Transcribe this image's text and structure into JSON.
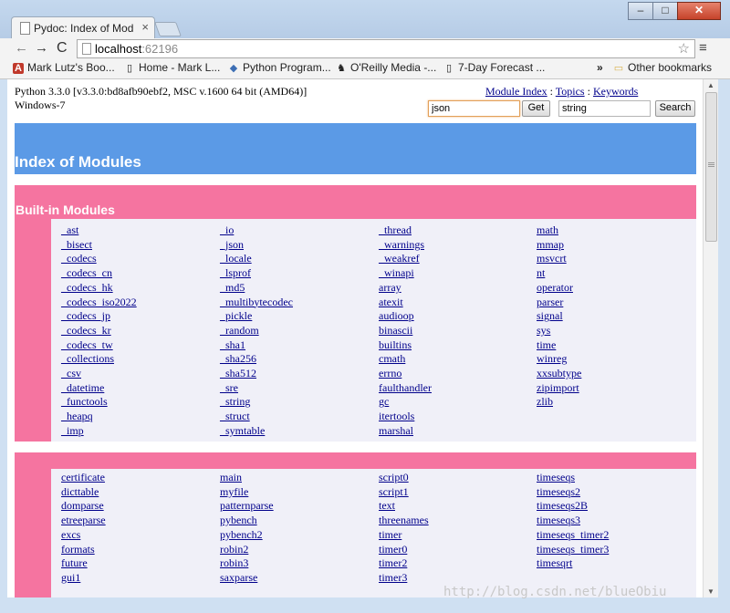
{
  "browser": {
    "tab_title": "Pydoc: Index of Mod",
    "tab_close": "×",
    "url_host": "localhost",
    "url_port": ":62196",
    "window_controls": {
      "minimize": "–",
      "maximize": "□",
      "close": "✕"
    },
    "nav_icons": {
      "back": "←",
      "forward": "→",
      "reload": "C",
      "star": "☆",
      "menu": "≡"
    },
    "bookmarks": [
      {
        "label": "Mark Lutz's Boo...",
        "icon": "acrobat-icon",
        "glyph": "A"
      },
      {
        "label": "Home - Mark L...",
        "icon": "page-icon",
        "glyph": "▯"
      },
      {
        "label": "Python Program...",
        "icon": "python-icon",
        "glyph": "◆"
      },
      {
        "label": "O'Reilly Media -...",
        "icon": "oreilly-icon",
        "glyph": "♞"
      },
      {
        "label": "7-Day Forecast ...",
        "icon": "page-icon",
        "glyph": "▯"
      }
    ],
    "bookmarks_more": "»",
    "other_bookmarks": {
      "label": "Other bookmarks",
      "glyph": "▭"
    }
  },
  "page": {
    "version_line1": "Python 3.3.0 [v3.3.0:bd8afb90ebf2, MSC v.1600 64 bit (AMD64)]",
    "version_line2": "Windows-7",
    "links": {
      "module_index": "Module Index",
      "topics": "Topics",
      "keywords": "Keywords",
      "separator": " : "
    },
    "get_input_value": "json",
    "get_button": "Get",
    "search_input_value": "string",
    "search_button": "Search",
    "index_title": "Index of Modules",
    "builtin_title": "Built-in Modules",
    "builtin_columns": [
      [
        "_ast",
        "_bisect",
        "_codecs",
        "_codecs_cn",
        "_codecs_hk",
        "_codecs_iso2022",
        "_codecs_jp",
        "_codecs_kr",
        "_codecs_tw",
        "_collections",
        "_csv",
        "_datetime",
        "_functools",
        "_heapq",
        "_imp"
      ],
      [
        "_io",
        "_json",
        "_locale",
        "_lsprof",
        "_md5",
        "_multibytecodec",
        "_pickle",
        "_random",
        "_sha1",
        "_sha256",
        "_sha512",
        "_sre",
        "_string",
        "_struct",
        "_symtable"
      ],
      [
        "_thread",
        "_warnings",
        "_weakref",
        "_winapi",
        "array",
        "atexit",
        "audioop",
        "binascii",
        "builtins",
        "cmath",
        "errno",
        "faulthandler",
        "gc",
        "itertools",
        "marshal"
      ],
      [
        "math",
        "mmap",
        "msvcrt",
        "nt",
        "operator",
        "parser",
        "signal",
        "sys",
        "time",
        "winreg",
        "xxsubtype",
        "zipimport",
        "zlib"
      ]
    ],
    "user_columns": [
      [
        "certificate",
        "dicttable",
        "domparse",
        "etreeparse",
        "excs",
        "formats",
        "future",
        "gui1"
      ],
      [
        "main",
        "myfile",
        "patternparse",
        "pybench",
        "pybench2",
        "robin2",
        "robin3",
        "saxparse"
      ],
      [
        "script0",
        "script1",
        "text",
        "threenames",
        "timer",
        "timer0",
        "timer2",
        "timer3"
      ],
      [
        "timeseqs",
        "timeseqs2",
        "timeseqs2B",
        "timeseqs3",
        "timeseqs_timer2",
        "timeseqs_timer3",
        "timesqrt"
      ]
    ]
  },
  "watermark": "http://blog.csdn.net/blueObiu",
  "colors": {
    "index_heading": "#5b9ae6",
    "section_band": "#f574a0",
    "section_body": "#f0f0f8",
    "link": "#00008b"
  }
}
